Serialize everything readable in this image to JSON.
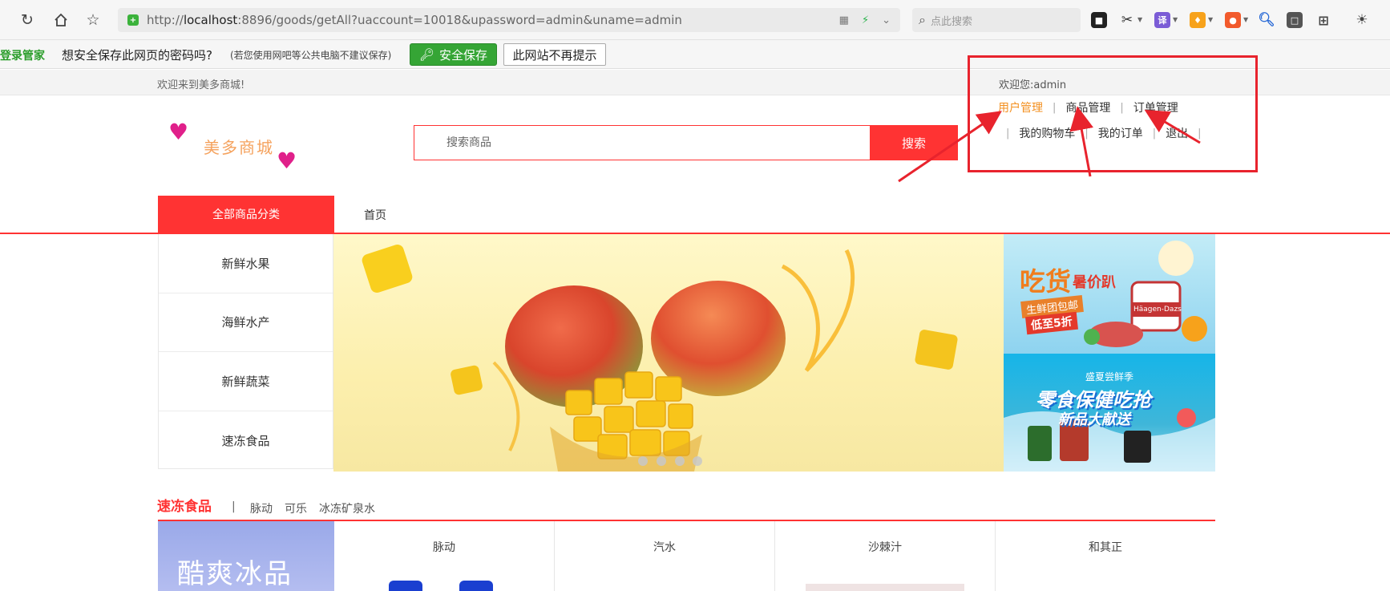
{
  "browser": {
    "url_prefix": "http://",
    "url_host": "localhost",
    "url_rest": ":8896/goods/getAll?uaccount=10018&upassword=admin&uname=admin",
    "search_placeholder": "点此搜索",
    "translate_ext": "译"
  },
  "password_bar": {
    "title": "登录管家",
    "question": "想安全保存此网页的密码吗?",
    "note": "(若您使用网吧等公共电脑不建议保存)",
    "save_label": "安全保存",
    "never_label": "此网站不再提示"
  },
  "topbar": {
    "welcome": "欢迎来到美多商城!",
    "user_greeting": "欢迎您:admin"
  },
  "header": {
    "logo_text": "美多商城",
    "search_placeholder": "搜索商品",
    "search_button": "搜索",
    "admin_links": [
      "用户管理",
      "商品管理",
      "订单管理"
    ],
    "user_links": [
      "我的购物车",
      "我的订单",
      "退出"
    ]
  },
  "nav": {
    "all_categories": "全部商品分类",
    "home": "首页"
  },
  "side_menu": [
    "新鲜水果",
    "海鲜水产",
    "新鲜蔬菜",
    "速冻食品"
  ],
  "ads": {
    "ad1_title": "吃货",
    "ad1_sub": "暑价趴",
    "ad1_tag1": "生鲜团包邮",
    "ad1_tag2": "低至5折",
    "ad1_brand": "Häagen-Dazs",
    "ad2_top": "盛夏尝鲜季",
    "ad2_main": "零食保健吃抢",
    "ad2_sub": "新品大献送"
  },
  "section": {
    "title": "速冻食品",
    "separator": "|",
    "tags": [
      "脉动",
      "可乐",
      "冰冻矿泉水"
    ],
    "promo": "酷爽冰品",
    "products": [
      "脉动",
      "汽水",
      "沙棘汁",
      "和其正"
    ]
  },
  "colors": {
    "brand_red": "#ff3333",
    "active_orange": "#f39020",
    "annotation_red": "#e8232d"
  }
}
